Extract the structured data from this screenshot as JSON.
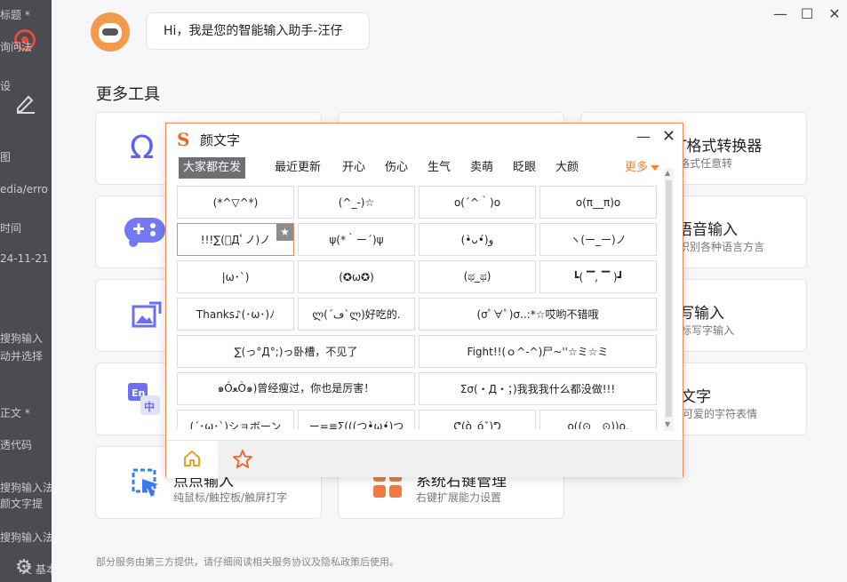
{
  "background": {
    "fragments": [
      "标题 *",
      "询问法",
      "设",
      "图",
      "edia/erro",
      "时间",
      "24-11-21",
      "搜狗输入",
      "动并选择",
      "正文 *",
      "透代码",
      "搜狗输入法",
      "颜文字提",
      "搜狗输入法",
      "文 基本"
    ]
  },
  "window": {
    "minimize": "—",
    "maximize": "☐",
    "close": "✕"
  },
  "assistant": {
    "greeting": "Hi，我是您的智能输入助手-汪仔"
  },
  "section_title": "更多工具",
  "cards": [
    {
      "title": "",
      "subtitle": "",
      "icon": "omega-icon",
      "color": "#5b63f0"
    },
    {
      "title": "",
      "subtitle": "",
      "icon": "",
      "color": "#5b63f0"
    },
    {
      "title": "T格式转换器",
      "subtitle": "格式任意转",
      "icon": "",
      "color": "#5b63f0"
    },
    {
      "title": "",
      "subtitle": "",
      "icon": "gamepad-icon",
      "color": "#6b70f2"
    },
    {
      "title": "",
      "subtitle": "",
      "icon": "",
      "color": "#5b63f0"
    },
    {
      "title": "语音输入",
      "subtitle": "识别各种语言方言",
      "icon": "",
      "color": "#5b63f0"
    },
    {
      "title": "",
      "subtitle": "",
      "icon": "image-edit-icon",
      "color": "#6b70f2"
    },
    {
      "title": "",
      "subtitle": "",
      "icon": "",
      "color": "#5b63f0"
    },
    {
      "title": "写输入",
      "subtitle": "标写字输入",
      "icon": "",
      "color": "#5b63f0"
    },
    {
      "title": "",
      "subtitle": "",
      "icon": "translate-icon",
      "color": "#6b70f2"
    },
    {
      "title": "",
      "subtitle": "",
      "icon": "",
      "color": "#5b63f0"
    },
    {
      "title": "文字",
      "subtitle": "可爱的字符表情",
      "icon": "",
      "color": "#5b63f0"
    },
    {
      "title": "点点输入",
      "subtitle": "纯鼠标/触控板/触屏打字",
      "icon": "cursor-click-icon",
      "color": "#3b7bf0"
    },
    {
      "title": "系统右键管理",
      "subtitle": "右键扩展能力设置",
      "icon": "grid-apps-icon",
      "color": "#ee7a45"
    }
  ],
  "footer": "部分服务由第三方提供，请仔细阅读相关服务协议及隐私政策后使用。",
  "popup": {
    "logo": "S",
    "title": "颜文字",
    "minimize": "—",
    "close": "✕",
    "tabs": [
      "大家都在发",
      "最近更新",
      "开心",
      "伤心",
      "生气",
      "卖萌",
      "眨眼",
      "大颜"
    ],
    "active_tab": 0,
    "more": "更多",
    "rows": [
      [
        "(*^▽^*)",
        "(^_-)☆",
        "o(´^｀)o",
        "o(π__π)o"
      ],
      [
        "!!!∑(ﾟДﾟノ)ノ",
        "ψ(*｀ー´)ψ",
        "(•̀ᴗ•́)و",
        "ヽ(ー_ー)ノ"
      ],
      [
        "|ω･`)",
        "(✪ω✪)",
        "(ಥ_ಥ)",
        "┗( ▔, ▔ )┛"
      ],
      [
        "Thanks♪(･ω･)ﾉ",
        "ლ(´ڡ`ლ)好吃的.",
        "(σﾟ∀ﾟ)σ..:*☆哎哟不错哦"
      ],
      [
        "∑(っ°Д°;)っ卧槽，不见了",
        "Fight!!(ｏ^-^)尸~''☆ミ☆ミ"
      ],
      [
        "๑ÓﻌÒ๑)曾经瘦过，你也是厉害！",
        "Σσ(・Д・；)我我我什么都没做!!!"
      ],
      [
        "(´･ω･`)ショボーン",
        "ー=≡Σ(((つ•̀ω•́)つ",
        "ᕦ(ò_óˇ)ᕤ",
        "o((⊙﹏⊙))o."
      ]
    ],
    "selected_item": "!!!∑(ﾟДﾟノ)ノ",
    "star_glyph": "★",
    "accent_color": "#f26322"
  }
}
